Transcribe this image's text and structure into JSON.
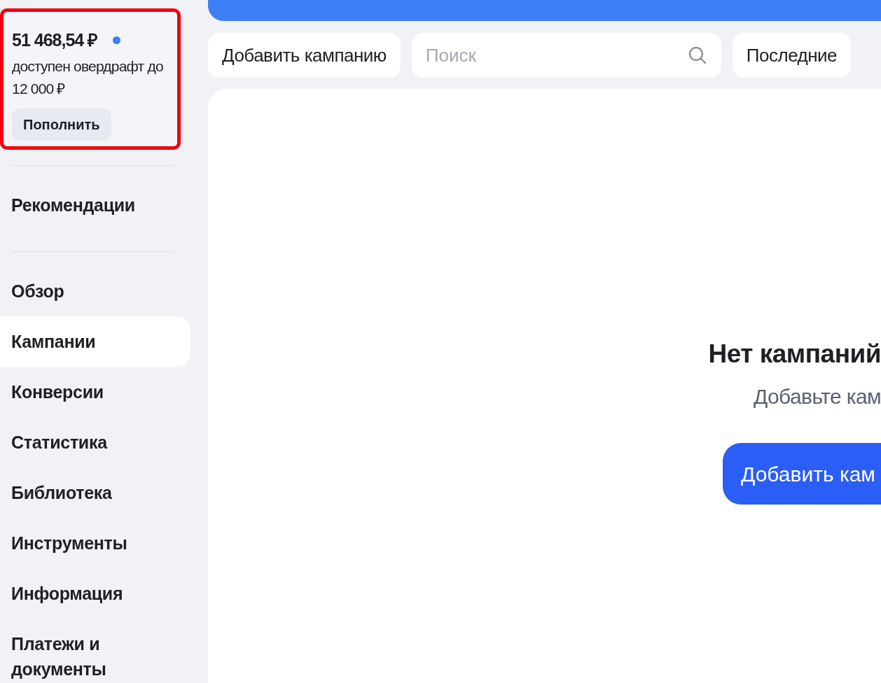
{
  "balance": {
    "amount": "51 468,54 ₽",
    "overdraft": "доступен овердрафт до 12 000 ₽",
    "button": "Пополнить",
    "highlighted": true
  },
  "sidebar": {
    "sections": [
      {
        "items": [
          {
            "label": "Рекомендации",
            "selected": false
          }
        ]
      },
      {
        "items": [
          {
            "label": "Обзор",
            "selected": false
          },
          {
            "label": "Кампании",
            "selected": true
          },
          {
            "label": "Конверсии",
            "selected": false
          },
          {
            "label": "Статистика",
            "selected": false
          },
          {
            "label": "Библиотека",
            "selected": false
          },
          {
            "label": "Инструменты",
            "selected": false
          },
          {
            "label": "Информация",
            "selected": false
          },
          {
            "label": "Платежи и документы",
            "selected": false
          }
        ]
      }
    ]
  },
  "toolbar": {
    "add_button": "Добавить кампанию",
    "search": {
      "placeholder": "Поиск"
    },
    "recent_button": "Последние"
  },
  "empty_state": {
    "title": "Нет кампаний",
    "text": "Добавьте кам",
    "button": "Добавить кам"
  }
}
